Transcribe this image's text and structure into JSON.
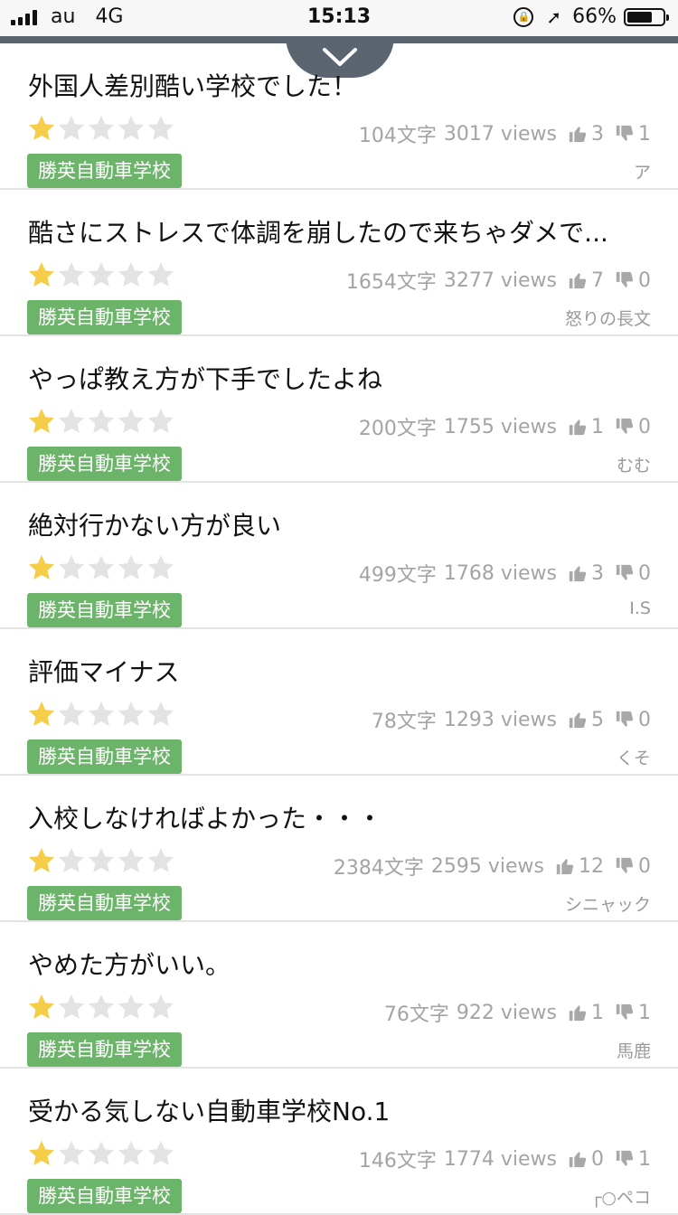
{
  "status": {
    "carrier": "au",
    "network": "4G",
    "time": "15:13",
    "battery": "66%"
  },
  "colors": {
    "tag": "#6db46b",
    "star_on": "#f5cd48",
    "star_off": "#e3e3e3"
  },
  "reviews": [
    {
      "title": "外国人差別酷い学校でした！",
      "rating": 1,
      "chars": "104文字",
      "views": "3017 views",
      "likes": "3",
      "dislikes": "1",
      "school": "勝英自動車学校",
      "author": "ア"
    },
    {
      "title": "酷さにストレスで体調を崩したので来ちゃダメで...",
      "rating": 1,
      "chars": "1654文字",
      "views": "3277 views",
      "likes": "7",
      "dislikes": "0",
      "school": "勝英自動車学校",
      "author": "怒りの長文"
    },
    {
      "title": "やっぱ教え方が下手でしたよね",
      "rating": 1,
      "chars": "200文字",
      "views": "1755 views",
      "likes": "1",
      "dislikes": "0",
      "school": "勝英自動車学校",
      "author": "むむ"
    },
    {
      "title": "絶対行かない方が良い",
      "rating": 1,
      "chars": "499文字",
      "views": "1768 views",
      "likes": "3",
      "dislikes": "0",
      "school": "勝英自動車学校",
      "author": "I.S"
    },
    {
      "title": "評価マイナス",
      "rating": 1,
      "chars": "78文字",
      "views": "1293 views",
      "likes": "5",
      "dislikes": "0",
      "school": "勝英自動車学校",
      "author": "くそ"
    },
    {
      "title": "入校しなければよかった・・・",
      "rating": 1,
      "chars": "2384文字",
      "views": "2595 views",
      "likes": "12",
      "dislikes": "0",
      "school": "勝英自動車学校",
      "author": "シニャック"
    },
    {
      "title": "やめた方がいい。",
      "rating": 1,
      "chars": "76文字",
      "views": "922 views",
      "likes": "1",
      "dislikes": "1",
      "school": "勝英自動車学校",
      "author": "馬鹿"
    },
    {
      "title": "受かる気しない自動車学校No.1",
      "rating": 1,
      "chars": "146文字",
      "views": "1774 views",
      "likes": "0",
      "dislikes": "1",
      "school": "勝英自動車学校",
      "author": "┌○ペコ"
    }
  ]
}
